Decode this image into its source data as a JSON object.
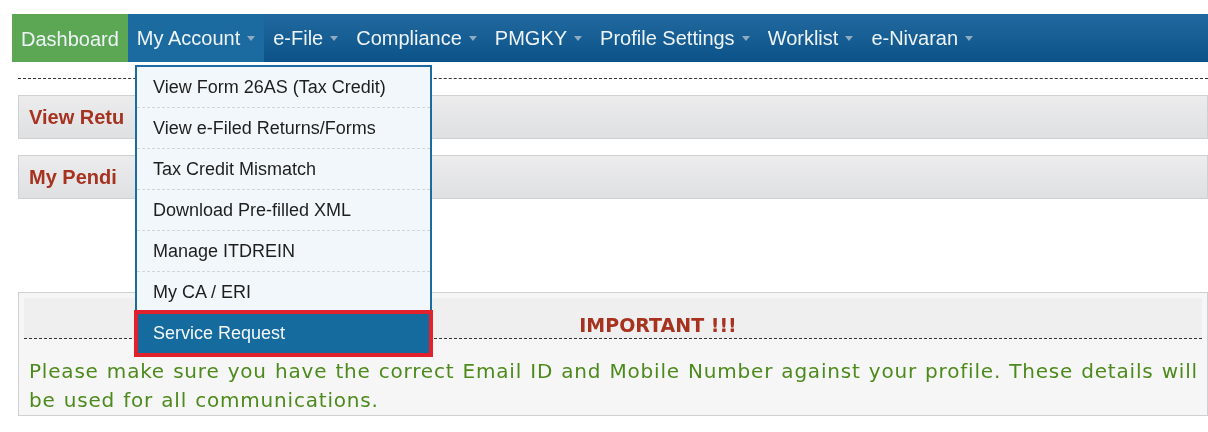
{
  "nav": [
    {
      "label": "Dashboard",
      "kind": "home",
      "selected": false,
      "caret": false
    },
    {
      "label": "My Account",
      "kind": "menu",
      "selected": true,
      "caret": true
    },
    {
      "label": "e-File",
      "kind": "menu",
      "selected": false,
      "caret": true
    },
    {
      "label": "Compliance",
      "kind": "menu",
      "selected": false,
      "caret": true
    },
    {
      "label": "PMGKY",
      "kind": "menu",
      "selected": false,
      "caret": true
    },
    {
      "label": "Profile Settings",
      "kind": "menu",
      "selected": false,
      "caret": true
    },
    {
      "label": "Worklist",
      "kind": "menu",
      "selected": false,
      "caret": true
    },
    {
      "label": "e-Nivaran",
      "kind": "menu",
      "selected": false,
      "caret": true
    }
  ],
  "dropdown": {
    "items": [
      {
        "label": "View Form 26AS (Tax Credit)",
        "selected": false,
        "outlined": false
      },
      {
        "label": "View e-Filed Returns/Forms",
        "selected": false,
        "outlined": false
      },
      {
        "label": "Tax Credit Mismatch",
        "selected": false,
        "outlined": false
      },
      {
        "label": "Download Pre-filled XML",
        "selected": false,
        "outlined": false
      },
      {
        "label": "Manage ITDREIN",
        "selected": false,
        "outlined": false
      },
      {
        "label": "My CA / ERI",
        "selected": false,
        "outlined": false
      },
      {
        "label": "Service Request",
        "selected": true,
        "outlined": true
      }
    ]
  },
  "panels": [
    {
      "title": "View Retu"
    },
    {
      "title": "My Pendi"
    }
  ],
  "notice": {
    "title": "IMPORTANT !!!",
    "text": "Please make sure you have the correct Email ID and Mobile Number against your profile. These details will be used for all communications."
  }
}
